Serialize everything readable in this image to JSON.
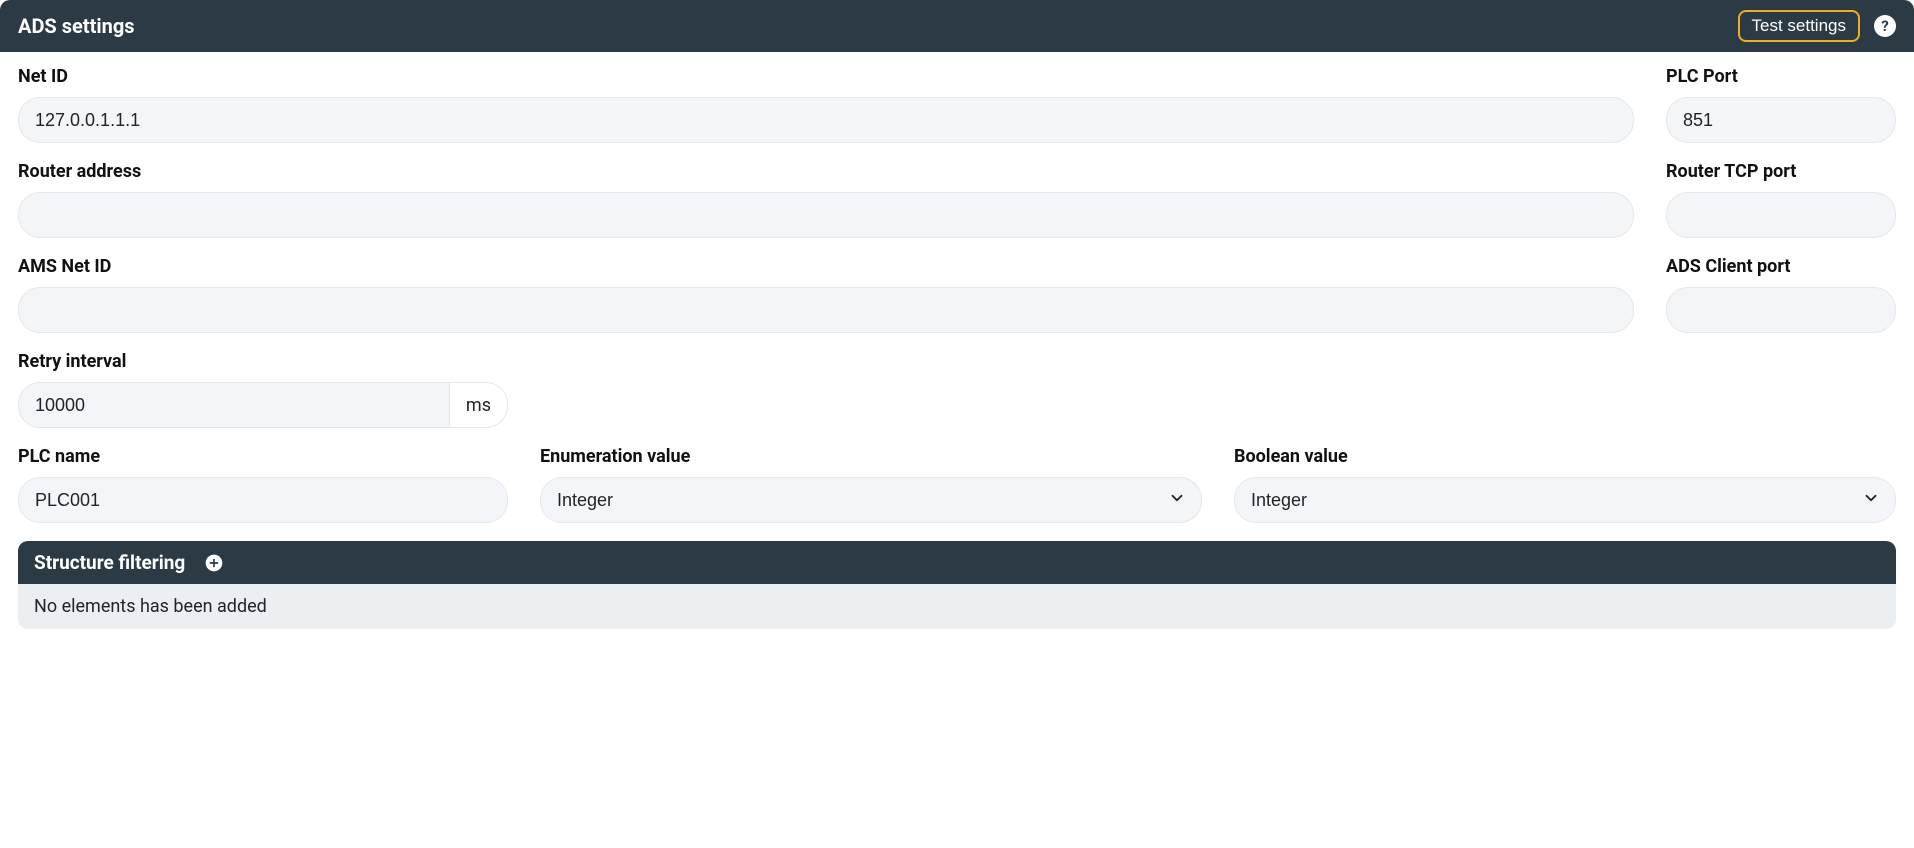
{
  "header": {
    "title": "ADS settings",
    "test_button": "Test settings"
  },
  "fields": {
    "net_id": {
      "label": "Net ID",
      "value": "127.0.0.1.1.1"
    },
    "plc_port": {
      "label": "PLC Port",
      "value": "851"
    },
    "router_address": {
      "label": "Router address",
      "value": ""
    },
    "router_tcp_port": {
      "label": "Router TCP port",
      "value": ""
    },
    "ams_net_id": {
      "label": "AMS Net ID",
      "value": ""
    },
    "ads_client_port": {
      "label": "ADS Client port",
      "value": ""
    },
    "retry_interval": {
      "label": "Retry interval",
      "value": "10000",
      "unit": "ms"
    },
    "plc_name": {
      "label": "PLC name",
      "value": "PLC001"
    },
    "enum_value": {
      "label": "Enumeration value",
      "value": "Integer"
    },
    "bool_value": {
      "label": "Boolean value",
      "value": "Integer"
    }
  },
  "structure_filtering": {
    "title": "Structure filtering",
    "empty_text": "No elements has been added"
  }
}
